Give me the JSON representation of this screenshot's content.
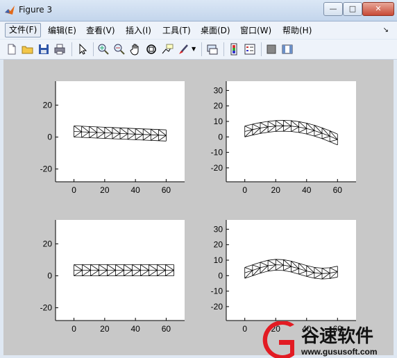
{
  "window": {
    "title": "Figure 3",
    "minimize_label": "—",
    "maximize_label": "□",
    "close_label": "✕"
  },
  "menu": {
    "items": [
      {
        "label": "文件(F)"
      },
      {
        "label": "编辑(E)"
      },
      {
        "label": "查看(V)"
      },
      {
        "label": "插入(I)"
      },
      {
        "label": "工具(T)"
      },
      {
        "label": "桌面(D)"
      },
      {
        "label": "窗口(W)"
      },
      {
        "label": "帮助(H)"
      }
    ]
  },
  "toolbar": {
    "icons": [
      "new-file-icon",
      "open-folder-icon",
      "save-icon",
      "print-icon",
      "pointer-icon",
      "zoom-in-icon",
      "zoom-out-icon",
      "pan-hand-icon",
      "rotate-3d-icon",
      "data-cursor-icon",
      "brush-icon",
      "link-icon",
      "colorbar-icon",
      "legend-icon",
      "hide-plot-tools-icon",
      "show-plot-tools-icon"
    ]
  },
  "chart_data": [
    {
      "type": "line",
      "description_type": "beam mesh",
      "title": "",
      "xlabel": "",
      "ylabel": "",
      "xlim": [
        -12,
        72
      ],
      "ylim": [
        -28,
        35
      ],
      "xticks": [
        "0",
        "20",
        "40",
        "60"
      ],
      "yticks": [
        "-20",
        "0",
        "20"
      ],
      "beam": {
        "length": 60,
        "width": 7,
        "tip_deflection": -2.5,
        "shape": "linear"
      }
    },
    {
      "type": "line",
      "description_type": "beam mesh",
      "title": "",
      "xlabel": "",
      "ylabel": "",
      "xlim": [
        -12,
        72
      ],
      "ylim": [
        -29,
        36
      ],
      "xticks": [
        "0",
        "20",
        "40",
        "60"
      ],
      "yticks": [
        "-20",
        "-10",
        "0",
        "10",
        "20",
        "30"
      ],
      "beam": {
        "length": 60,
        "width": 7,
        "tip_deflection": -6,
        "shape": "arch"
      }
    },
    {
      "type": "line",
      "description_type": "beam mesh",
      "title": "",
      "xlabel": "",
      "ylabel": "",
      "xlim": [
        -12,
        72
      ],
      "ylim": [
        -28,
        35
      ],
      "xticks": [
        "0",
        "20",
        "40",
        "60"
      ],
      "yticks": [
        "-20",
        "0",
        "20"
      ],
      "beam": {
        "length": 65,
        "width": 7,
        "tip_deflection": 0,
        "shape": "straight"
      }
    },
    {
      "type": "line",
      "description_type": "beam mesh",
      "title": "",
      "xlabel": "",
      "ylabel": "",
      "xlim": [
        -12,
        72
      ],
      "ylim": [
        -29,
        36
      ],
      "xticks": [
        "0",
        "20",
        "40",
        "60"
      ],
      "yticks": [
        "-20",
        "-10",
        "0",
        "10",
        "20",
        "30"
      ],
      "beam": {
        "length": 60,
        "width": 7,
        "tip_deflection": -4,
        "shape": "wave"
      }
    }
  ],
  "watermark": {
    "brand": "谷速软件",
    "url": "www.gususoft.com"
  }
}
